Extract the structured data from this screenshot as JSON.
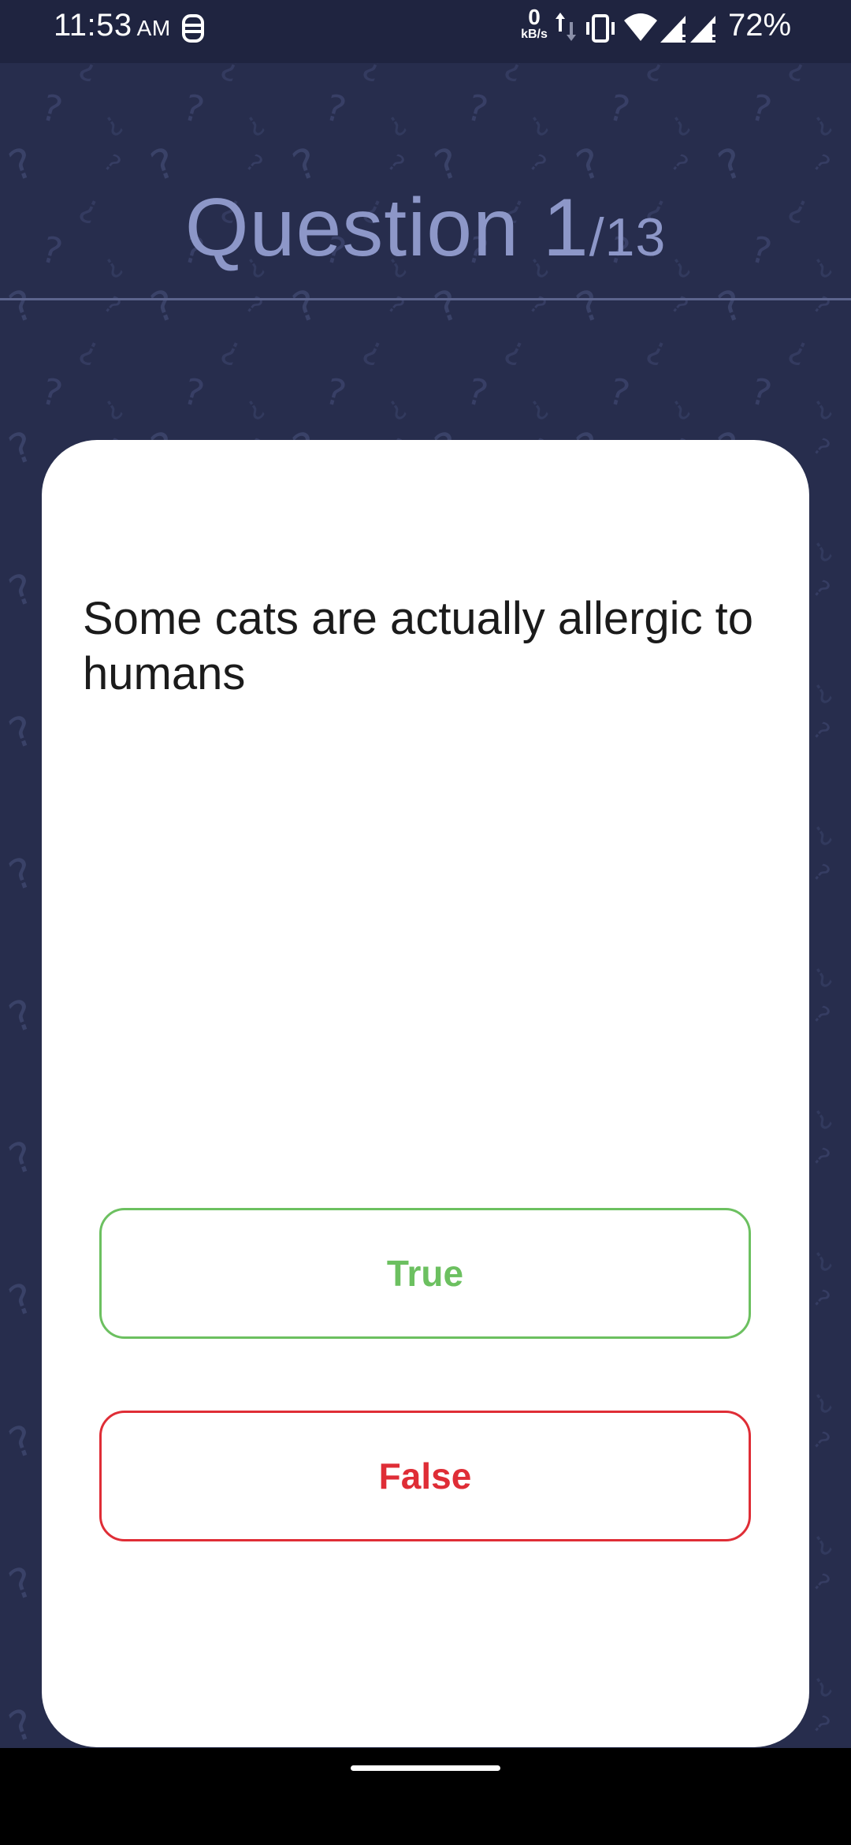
{
  "status_bar": {
    "time": "11:53",
    "ampm": "AM",
    "net_speed_value": "0",
    "net_speed_unit": "kB/s",
    "battery": "72%",
    "icons": [
      "notification-icon",
      "data-arrows-icon",
      "vibrate-icon",
      "wifi-icon",
      "signal-icon",
      "signal-icon"
    ]
  },
  "header": {
    "question_label": "Question 1",
    "total": "/13"
  },
  "question": {
    "text": "Some cats are actually allergic to humans"
  },
  "answers": {
    "true_label": "True",
    "false_label": "False"
  },
  "colors": {
    "background": "#272d4d",
    "header_text": "#8d97c8",
    "true": "#6cc060",
    "false": "#df2d36"
  }
}
